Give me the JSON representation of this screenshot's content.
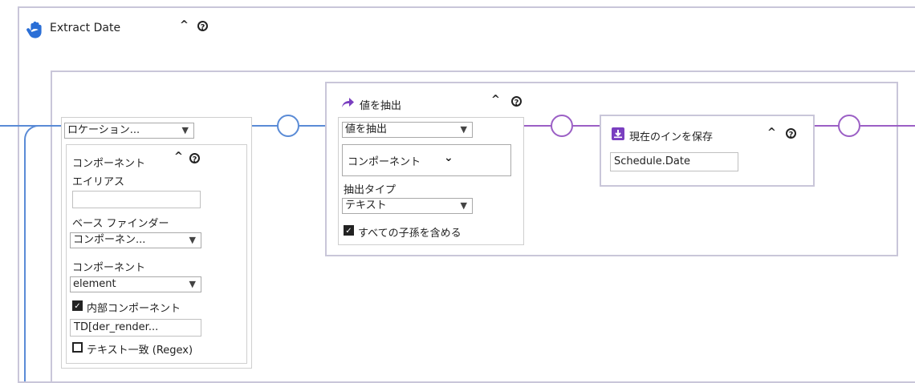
{
  "title": "Extract Date",
  "location": {
    "dropdown_value": "ロケーション...",
    "component_title": "コンポーネント",
    "alias_label": "エイリアス",
    "alias_value": "",
    "base_finder_label": "ベース ファインダー",
    "base_finder_value": "コンポーネン...",
    "component_label": "コンポーネント",
    "component_value": "element",
    "internal_label": "内部コンポーネント",
    "internal_checked": true,
    "selector_value": "TD[der_render...",
    "regex_label": "テキスト一致 (Regex)",
    "regex_checked": false
  },
  "extract": {
    "title": "値を抽出",
    "dropdown_value": "値を抽出",
    "component_value": "コンポーネント",
    "type_label": "抽出タイプ",
    "type_value": "テキスト",
    "descendants_label": "すべての子孫を含める",
    "descendants_checked": true
  },
  "save": {
    "title": "現在のインを保存",
    "value": "Schedule.Date"
  },
  "colors": {
    "blue_line": "#5a8bd6",
    "purple_line": "#9b5fc5",
    "frame_border": "#c9c6d9"
  }
}
